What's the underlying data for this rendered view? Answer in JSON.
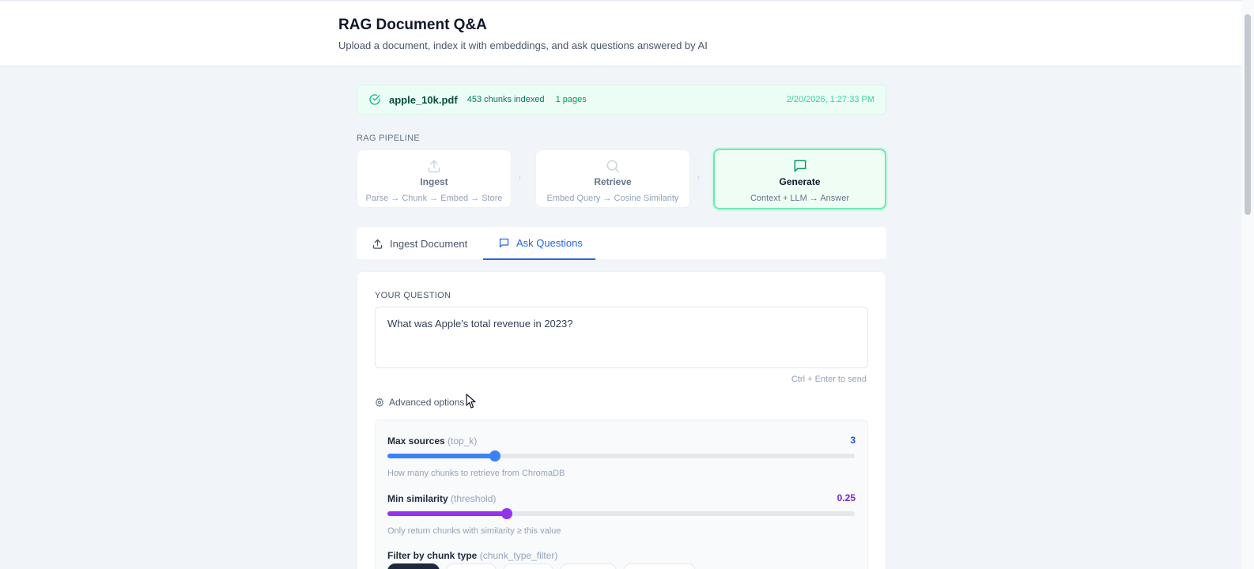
{
  "header": {
    "title": "RAG Document Q&A",
    "subtitle": "Upload a document, index it with embeddings, and ask questions answered by AI"
  },
  "status": {
    "filename": "apple_10k.pdf",
    "chunks": "453 chunks indexed",
    "pages": "1 pages",
    "timestamp": "2/20/2026, 1:27:33 PM",
    "icon": "check-circle-icon"
  },
  "pipeline": {
    "label": "RAG PIPELINE",
    "steps": [
      {
        "name": "Ingest",
        "desc": "Parse → Chunk → Embed → Store",
        "icon": "upload-icon"
      },
      {
        "name": "Retrieve",
        "desc": "Embed Query → Cosine Similarity",
        "icon": "search-icon"
      },
      {
        "name": "Generate",
        "desc": "Context + LLM → Answer",
        "icon": "chat-icon",
        "active": true
      }
    ],
    "separator": "›"
  },
  "tabs": [
    {
      "label": "Ingest Document",
      "icon": "upload-icon"
    },
    {
      "label": "Ask Questions",
      "icon": "chat-icon",
      "active": true
    }
  ],
  "question": {
    "label": "YOUR QUESTION",
    "value": "What was Apple's total revenue in 2023?",
    "hint": "Ctrl + Enter to send"
  },
  "advanced": {
    "toggle_label": "Advanced options",
    "max_sources": {
      "label": "Max sources",
      "param": "(top_k)",
      "value": "3",
      "fill_fraction": 0.23,
      "help": "How many chunks to retrieve from ChromaDB",
      "color": "#3b82f6"
    },
    "min_similarity": {
      "label": "Min similarity",
      "param": "(threshold)",
      "value": "0.25",
      "fill_fraction": 0.255,
      "help": "Only return chunks with similarity ≥ this value",
      "color": "#9333ea"
    },
    "filter": {
      "label": "Filter by chunk type",
      "param": "(chunk_type_filter)"
    }
  },
  "colors": {
    "accent": "#2563eb",
    "success": "#10b981",
    "similarity": "#9333ea"
  }
}
